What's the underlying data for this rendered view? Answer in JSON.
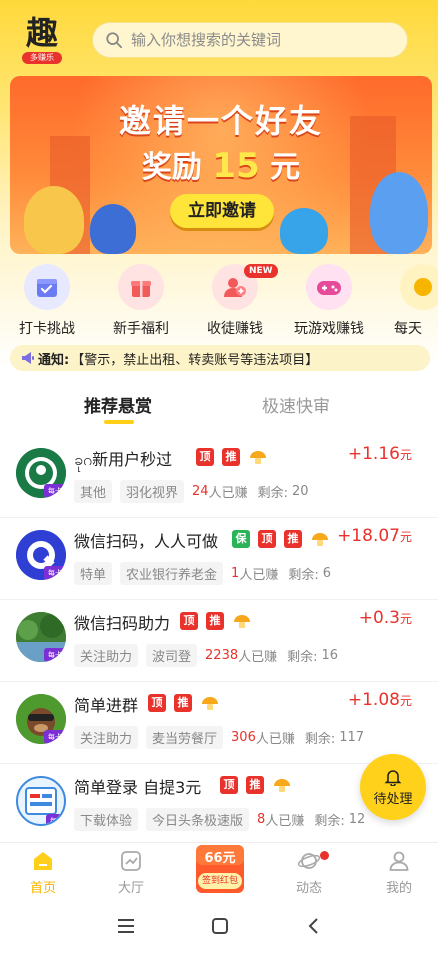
{
  "header": {
    "logo_char": "趣",
    "logo_sub": "多赚乐",
    "search_placeholder": "输入你想搜索的关键词"
  },
  "banner": {
    "line1": "邀请一个好友",
    "line2_prefix": "奖励",
    "line2_amount": "15",
    "line2_suffix": "元",
    "button_label": "立即邀请"
  },
  "quick_links": [
    {
      "label": "打卡挑战",
      "icon": "calendar-check-icon",
      "color": "#6b7cf3",
      "bg": "#e6e9ff"
    },
    {
      "label": "新手福利",
      "icon": "gift-icon",
      "color": "#f25a5a",
      "bg": "#ffe3e3"
    },
    {
      "label": "收徒赚钱",
      "icon": "users-icon",
      "color": "#f25a5a",
      "bg": "#ffe3e3",
      "badge": "NEW"
    },
    {
      "label": "玩游戏赚钱",
      "icon": "gamepad-icon",
      "color": "#e64a9a",
      "bg": "#ffe1f1"
    },
    {
      "label": "每天",
      "icon": "coin-icon",
      "color": "#f7b500",
      "bg": "#fff3c2"
    }
  ],
  "notice": {
    "prefix": "通知:",
    "text": "【警示，禁止出租、转卖账号等违法项目】"
  },
  "tabs": {
    "active": "推荐悬赏",
    "inactive": "极速快审"
  },
  "tasks": [
    {
      "title": "ခုဂ新用户秒过",
      "tags": [
        "顶",
        "推"
      ],
      "reward": "+1.16",
      "unit": "元",
      "category": "其他",
      "company": "羽化视界",
      "count": "24",
      "done_label": "人已赚",
      "remaining_label": "剩余:",
      "remaining": "20",
      "avatar_color": "#1a7a45"
    },
    {
      "title": "微信扫码，人人可做",
      "tags": [
        "保",
        "顶",
        "推"
      ],
      "reward": "+18.07",
      "unit": "元",
      "category": "特单",
      "company": "农业银行养老金",
      "count": "1",
      "done_label": "人已赚",
      "remaining_label": "剩余:",
      "remaining": "6",
      "avatar_color": "#2f3fd4"
    },
    {
      "title": "微信扫码助力",
      "tags": [
        "顶",
        "推"
      ],
      "reward": "+0.3",
      "unit": "元",
      "category": "关注助力",
      "company": "波司登",
      "count": "2238",
      "done_label": "人已赚",
      "remaining_label": "剩余:",
      "remaining": "16",
      "avatar_color": "#4a8a3a"
    },
    {
      "title": "简单进群",
      "tags": [
        "顶",
        "推"
      ],
      "reward": "+1.08",
      "unit": "元",
      "category": "关注助力",
      "company": "麦当劳餐厅",
      "count": "306",
      "done_label": "人已赚",
      "remaining_label": "剩余:",
      "remaining": "117",
      "avatar_color": "#3d8a2a"
    },
    {
      "title": "简单登录  自提3元",
      "tags": [
        "顶",
        "推"
      ],
      "reward": "",
      "unit": "",
      "category": "下载体验",
      "company": "今日头条极速版",
      "count": "8",
      "done_label": "人已赚",
      "remaining_label": "剩余:",
      "remaining": "12",
      "avatar_color": "#e8f4ff"
    }
  ],
  "avatar_badge": "每卡",
  "float_button": "待处理",
  "bottom_nav": {
    "home": "首页",
    "hall": "大厅",
    "promo_amount": "66元",
    "promo_label": "签到红包",
    "dynamics": "动态",
    "mine": "我的"
  },
  "colors": {
    "accent": "#ffd11a",
    "red": "#e8322b",
    "nav_active": "#f7b500"
  }
}
